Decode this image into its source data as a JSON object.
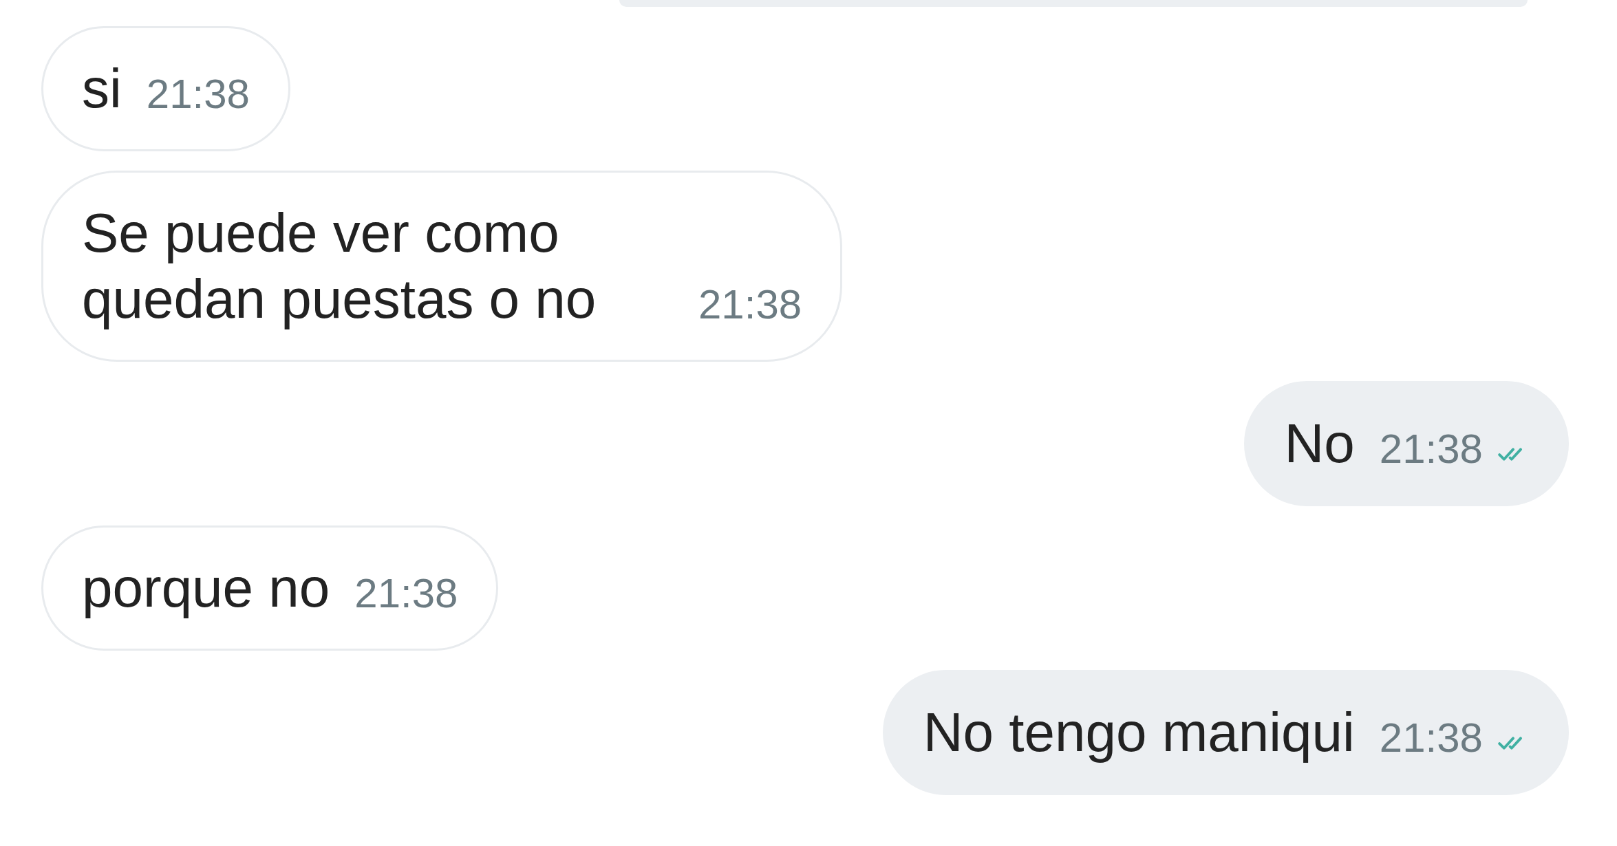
{
  "messages": [
    {
      "kind": "incoming",
      "text": "si",
      "time": "21:38"
    },
    {
      "kind": "incoming",
      "text": "Se puede ver como quedan puestas o no",
      "time": "21:38"
    },
    {
      "kind": "outgoing",
      "text": "No",
      "time": "21:38",
      "read": true
    },
    {
      "kind": "incoming",
      "text": "porque no",
      "time": "21:38"
    },
    {
      "kind": "outgoing",
      "text": "No tengo maniqui",
      "time": "21:38",
      "read": true
    }
  ]
}
